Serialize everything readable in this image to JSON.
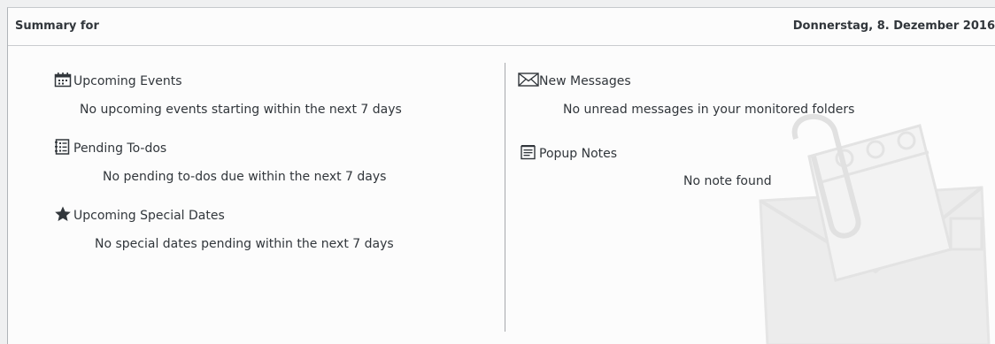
{
  "header": {
    "title": "Summary for",
    "date": "Donnerstag, 8. Dezember 2016"
  },
  "left_column": {
    "events": {
      "title": "Upcoming Events",
      "icon": "calendar-icon",
      "message": "No upcoming events starting within the next 7 days"
    },
    "todos": {
      "title": "Pending To-dos",
      "icon": "todo-list-icon",
      "message": "No pending to-dos due within the next 7 days"
    },
    "special_dates": {
      "title": "Upcoming Special Dates",
      "icon": "star-icon",
      "message": "No special dates pending within the next 7 days"
    }
  },
  "right_column": {
    "messages": {
      "title": "New Messages",
      "icon": "envelope-icon",
      "message": "No unread messages in your monitored folders"
    },
    "notes": {
      "title": "Popup Notes",
      "icon": "note-icon",
      "message": "No note found"
    }
  },
  "colors": {
    "text": "#31363b",
    "background": "#fcfcfc",
    "divider": "#a6a9ac"
  }
}
